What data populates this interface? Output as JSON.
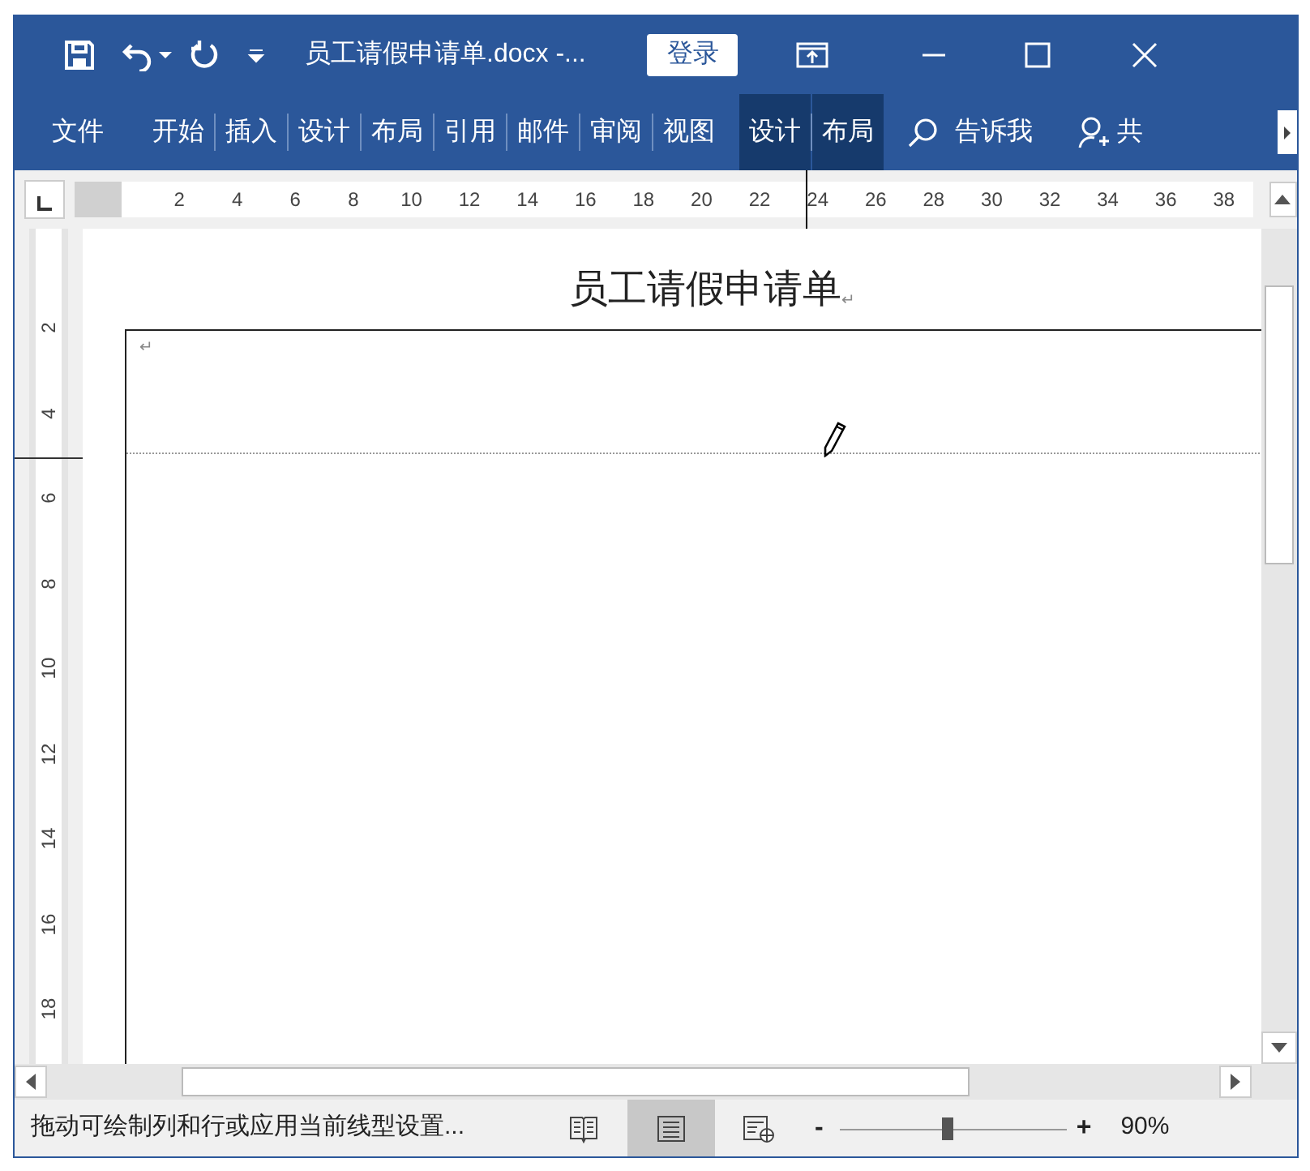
{
  "window": {
    "title": "员工请假申请单.docx  -...",
    "sign_in": "登录"
  },
  "ribbon_tabs": [
    {
      "label": "文件",
      "contextual": false
    },
    {
      "label": "开始",
      "contextual": false
    },
    {
      "label": "插入",
      "contextual": false
    },
    {
      "label": "设计",
      "contextual": false
    },
    {
      "label": "布局",
      "contextual": false
    },
    {
      "label": "引用",
      "contextual": false
    },
    {
      "label": "邮件",
      "contextual": false
    },
    {
      "label": "审阅",
      "contextual": false
    },
    {
      "label": "视图",
      "contextual": false
    },
    {
      "label": "设计",
      "contextual": true
    },
    {
      "label": "布局",
      "contextual": true
    }
  ],
  "tell_me": "告诉我",
  "share": "共",
  "ruler": {
    "horizontal": [
      "2",
      "4",
      "6",
      "8",
      "10",
      "12",
      "14",
      "16",
      "18",
      "20",
      "22",
      "24",
      "26",
      "28",
      "30",
      "32",
      "34",
      "36",
      "38"
    ],
    "vertical": [
      "2",
      "4",
      "6",
      "8",
      "10",
      "12",
      "14",
      "16",
      "18"
    ]
  },
  "document": {
    "title": "员工请假申请单",
    "paragraph_mark": "↵"
  },
  "status_bar": {
    "message": "拖动可绘制列和行或应用当前线型设置...",
    "views": [
      {
        "kind": "read",
        "selected": false
      },
      {
        "kind": "print",
        "selected": true
      },
      {
        "kind": "web",
        "selected": false
      }
    ],
    "zoom_out": "-",
    "zoom_in": "+",
    "zoom": "90%",
    "level": 0.47
  }
}
